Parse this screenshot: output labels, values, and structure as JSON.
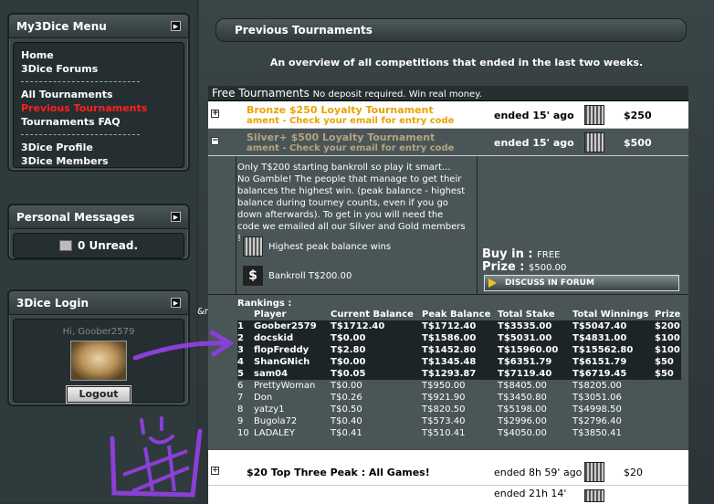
{
  "sidebar": {
    "menu_title": "My3Dice Menu",
    "menu_items": [
      {
        "label": "Home",
        "active": false
      },
      {
        "label": "3Dice Forums",
        "active": false
      },
      {
        "label": "All Tournaments",
        "active": false
      },
      {
        "label": "Previous Tournaments",
        "active": true
      },
      {
        "label": "Tournaments FAQ",
        "active": false
      },
      {
        "label": "3Dice Profile",
        "active": false
      },
      {
        "label": "3Dice Members",
        "active": false
      }
    ],
    "messages_title": "Personal Messages",
    "unread_label": "0 Unread.",
    "login_title": "3Dice Login",
    "greeting": "Hi, Goober2579",
    "logout_label": "Logout"
  },
  "main": {
    "title": "Previous Tournaments",
    "overview": "An overview of all competitions that ended in the last two weeks.",
    "category": {
      "name": "Free Tournaments",
      "note": "No deposit required. Win real money."
    },
    "tournaments": [
      {
        "name": "Bronze $250 Loyalty Tournament",
        "sub": "ament - Check your email for entry code",
        "ended": "ended 15' ago",
        "prize": "$250",
        "toggle": "+"
      },
      {
        "name": "Silver+ $500 Loyalty Tournament",
        "sub": "ament - Check your email for entry code",
        "ended": "ended 15' ago",
        "prize": "$500",
        "toggle": "−"
      }
    ],
    "detail": {
      "description": "Only T$200 starting bankroll so play it smart... No Gamble! The people that manage to get their balances the highest win. (peak balance - highest balance during tourney counts, even if you go down afterwards). To get in you will need the code we emailed all our Silver and Gold members !",
      "feature1": "Highest peak balance wins",
      "feature2": "Bankroll T$200.00",
      "buyin_label": "Buy in :",
      "buyin_value": "FREE",
      "prize_label": "Prize :",
      "prize_value": "$500.00",
      "discuss_label": "DISCUSS IN FORUM",
      "nbsp_text": "&nbsp"
    },
    "rankings": {
      "title": "Rankings :",
      "headers": [
        "",
        "Player",
        "Current Balance",
        "Peak Balance",
        "Total Stake",
        "Total Winnings",
        "Prize"
      ],
      "rows": [
        [
          "1",
          "Goober2579",
          "T$1712.40",
          "T$1712.40",
          "T$3535.00",
          "T$5047.40",
          "$200"
        ],
        [
          "2",
          "docskid",
          "T$0.00",
          "T$1586.00",
          "T$5031.00",
          "T$4831.00",
          "$100"
        ],
        [
          "3",
          "flopFreddy",
          "T$2.80",
          "T$1452.80",
          "T$15960.00",
          "T$15562.80",
          "$100"
        ],
        [
          "4",
          "ShanGNich",
          "T$0.00",
          "T$1345.48",
          "T$6351.79",
          "T$6151.79",
          "$50"
        ],
        [
          "5",
          "sam04",
          "T$0.05",
          "T$1293.87",
          "T$7119.40",
          "T$6719.45",
          "$50"
        ],
        [
          "6",
          "PrettyWoman",
          "T$0.00",
          "T$950.00",
          "T$8405.00",
          "T$8205.00",
          ""
        ],
        [
          "7",
          "Don",
          "T$0.26",
          "T$921.90",
          "T$3450.80",
          "T$3051.06",
          ""
        ],
        [
          "8",
          "yatzy1",
          "T$0.50",
          "T$820.50",
          "T$5198.00",
          "T$4998.50",
          ""
        ],
        [
          "9",
          "Bugola72",
          "T$0.40",
          "T$573.40",
          "T$2996.00",
          "T$2796.40",
          ""
        ],
        [
          "10",
          "LADALEY",
          "T$0.41",
          "T$510.41",
          "T$4050.00",
          "T$3850.41",
          ""
        ]
      ]
    },
    "next_tournament": {
      "name": "$20 Top Three Peak : All Games!",
      "ended": "ended 8h 59' ago",
      "prize": "$20",
      "toggle": "+"
    },
    "last_tournament": {
      "ended": "ended 21h 14'"
    }
  }
}
